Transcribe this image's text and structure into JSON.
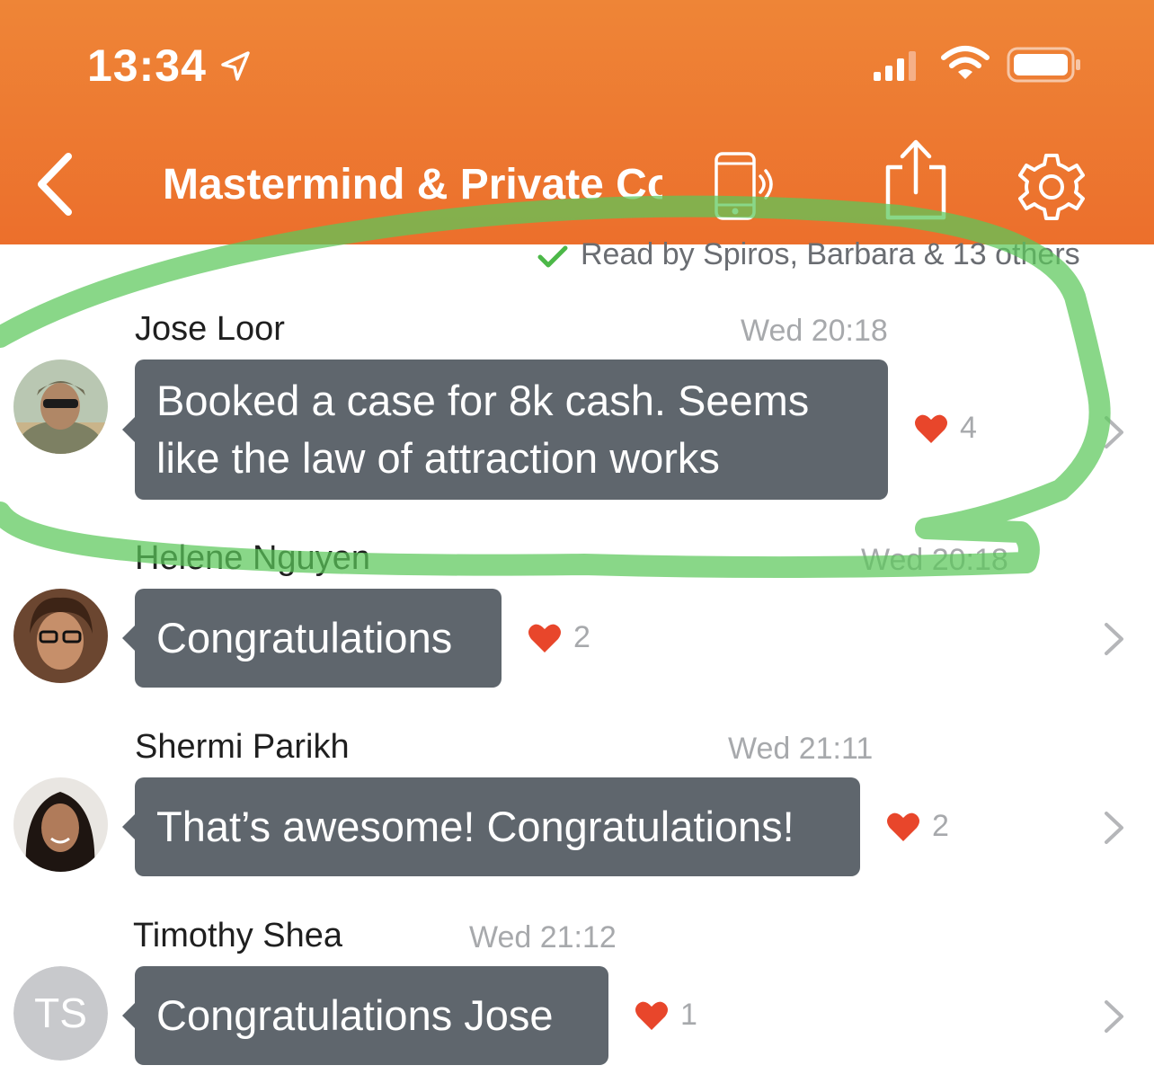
{
  "status_bar": {
    "time": "13:34",
    "icons": [
      "location-arrow-icon",
      "cell-signal-icon",
      "wifi-icon",
      "battery-icon"
    ]
  },
  "header": {
    "title": "Mastermind & Private Coaching",
    "background_color": "#ec7530",
    "icons": [
      "back-chevron-icon",
      "phone-sound-icon",
      "share-icon",
      "gear-icon"
    ]
  },
  "read_receipt": {
    "text": "Read by Spiros, Barbara & 13 others",
    "check_color": "#4cb848"
  },
  "messages": [
    {
      "sender": "Jose Loor",
      "time": "Wed 20:18",
      "text": "Booked a case for 8k cash. Seems like the law of attraction works",
      "likes": "4",
      "avatar": "photo"
    },
    {
      "sender": "Helene Nguyen",
      "time": "Wed 20:18",
      "text": "Congratulations",
      "likes": "2",
      "avatar": "photo"
    },
    {
      "sender": "Shermi Parikh",
      "time": "Wed 21:11",
      "text": "That’s awesome! Congratulations!",
      "likes": "2",
      "avatar": "photo"
    },
    {
      "sender": "Timothy Shea",
      "time": "Wed 21:12",
      "text": "Congratulations Jose",
      "likes": "1",
      "avatar_initials": "TS"
    }
  ],
  "colors": {
    "bubble": "#5f666d",
    "heart": "#e8462b",
    "annotation_highlight": "#5cc85a"
  }
}
